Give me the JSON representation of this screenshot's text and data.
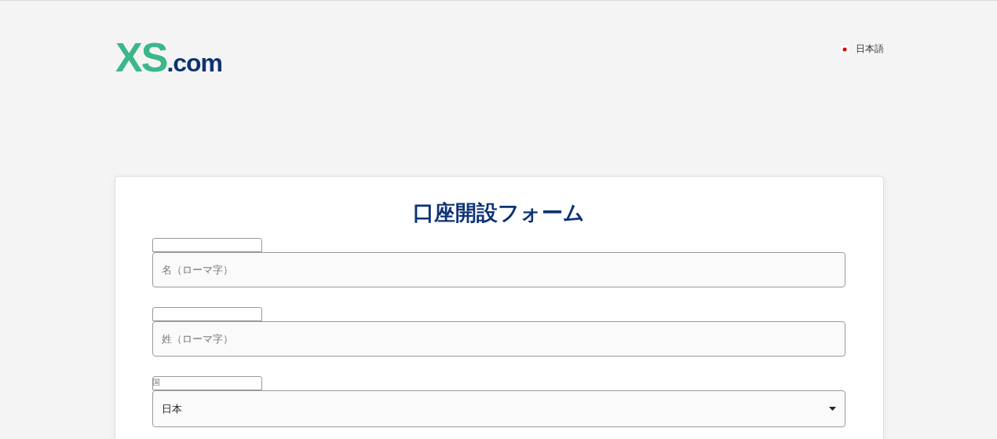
{
  "logo": {
    "main": "XS",
    "suffix": ".com"
  },
  "language": {
    "label": "日本語"
  },
  "form": {
    "title": "口座開設フォーム",
    "fields": [
      {
        "kind": "text",
        "placeholder": "名（ローマ字）"
      },
      {
        "kind": "text",
        "placeholder": "姓（ローマ字）"
      },
      {
        "kind": "select",
        "label": "国",
        "value": "日本"
      }
    ]
  }
}
